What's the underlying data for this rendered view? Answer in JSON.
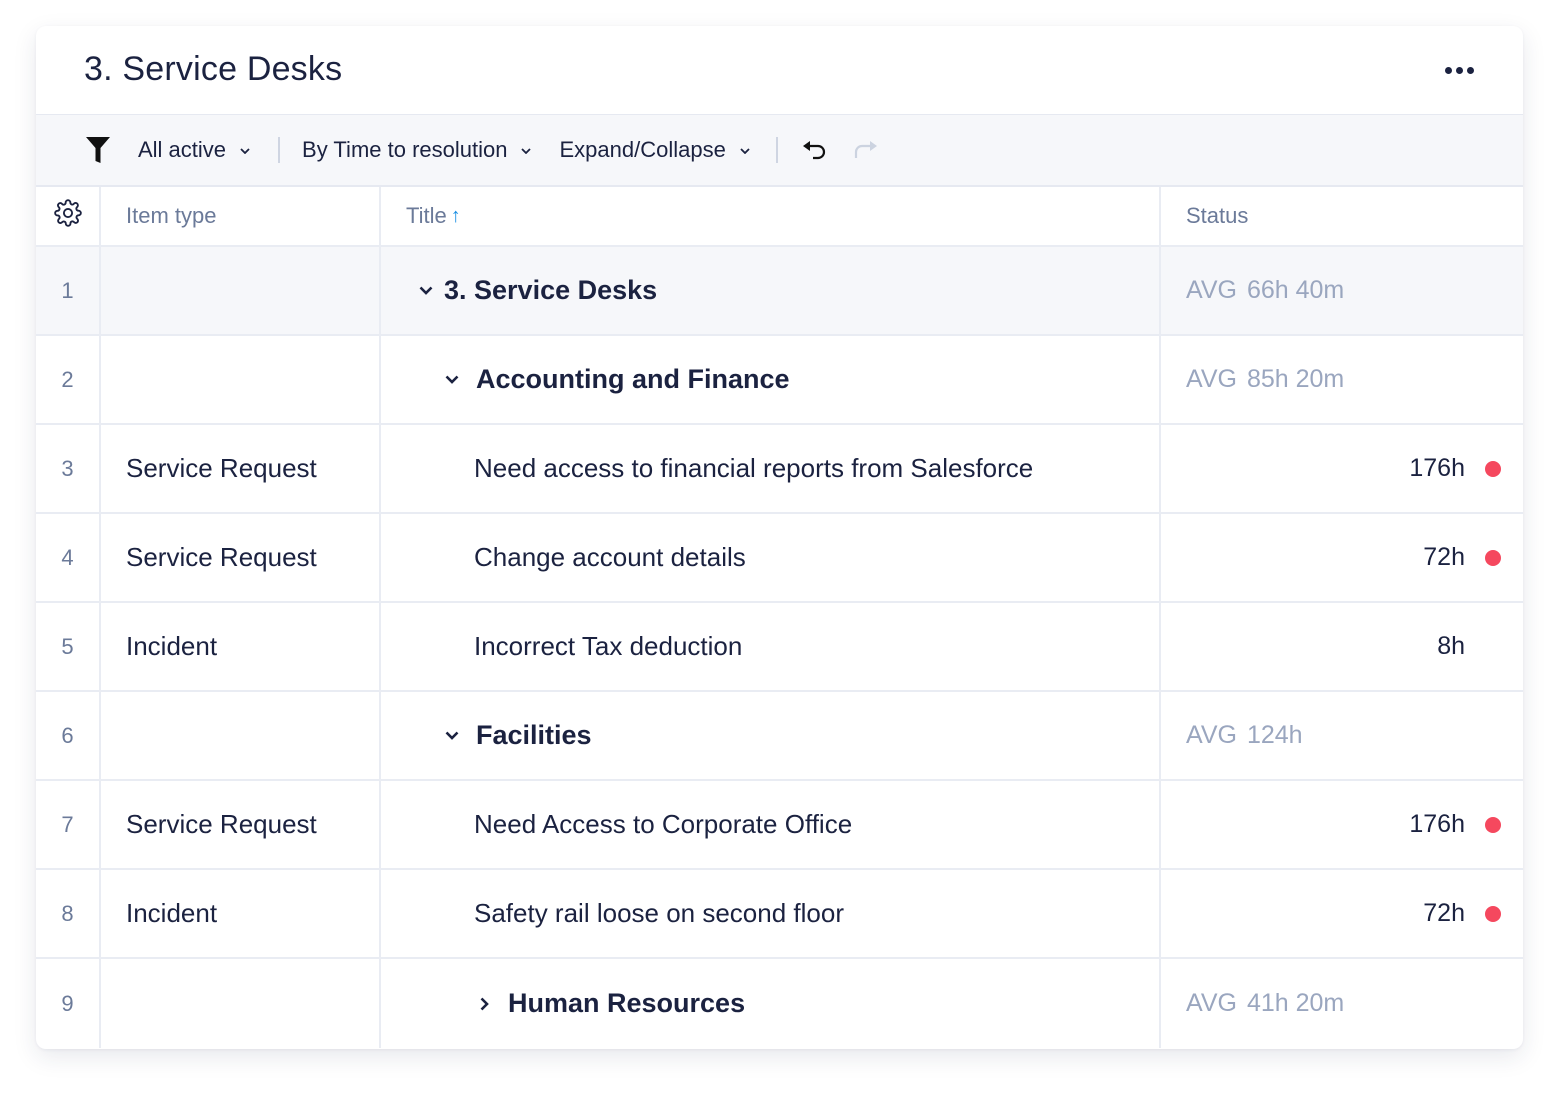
{
  "card": {
    "title": "3. Service Desks",
    "more_icon": "more-horizontal-icon"
  },
  "toolbar": {
    "filter_icon": "filter-icon",
    "filter_label": "All active",
    "sort_label": "By Time to resolution",
    "expand_label": "Expand/Collapse",
    "undo_icon": "undo-icon",
    "redo_icon": "redo-icon",
    "redo_enabled": false
  },
  "columns": {
    "settings_icon": "gear-icon",
    "item_type": "Item type",
    "title": "Title",
    "title_sort": "ascending",
    "status": "Status"
  },
  "colors": {
    "overdue_dot": "#f5485e",
    "sort_accent": "#1a8fe3",
    "text_primary": "#1b2240",
    "text_muted": "#9aa6bf"
  },
  "rows": [
    {
      "num": "1",
      "type": "",
      "title": "3. Service Desks",
      "kind": "group",
      "level": 0,
      "expanded": true,
      "avg_label": "AVG",
      "avg_value": "66h 40m"
    },
    {
      "num": "2",
      "type": "",
      "title": "Accounting and Finance",
      "kind": "group",
      "level": 1,
      "expanded": true,
      "avg_label": "AVG",
      "avg_value": "85h 20m"
    },
    {
      "num": "3",
      "type": "Service Request",
      "title": "Need access to financial reports from Salesforce",
      "kind": "item",
      "value": "176h",
      "overdue": true
    },
    {
      "num": "4",
      "type": "Service Request",
      "title": "Change account details",
      "kind": "item",
      "value": "72h",
      "overdue": true
    },
    {
      "num": "5",
      "type": "Incident",
      "title": "Incorrect Tax deduction",
      "kind": "item",
      "value": "8h",
      "overdue": false
    },
    {
      "num": "6",
      "type": "",
      "title": "Facilities",
      "kind": "group",
      "level": 1,
      "expanded": true,
      "avg_label": "AVG",
      "avg_value": "124h"
    },
    {
      "num": "7",
      "type": "Service Request",
      "title": "Need Access to Corporate Office",
      "kind": "item",
      "value": "176h",
      "overdue": true
    },
    {
      "num": "8",
      "type": "Incident",
      "title": "Safety rail loose on second floor",
      "kind": "item",
      "value": "72h",
      "overdue": true
    },
    {
      "num": "9",
      "type": "",
      "title": "Human Resources",
      "kind": "group",
      "level": 1,
      "expanded": false,
      "avg_label": "AVG",
      "avg_value": "41h 20m"
    }
  ]
}
